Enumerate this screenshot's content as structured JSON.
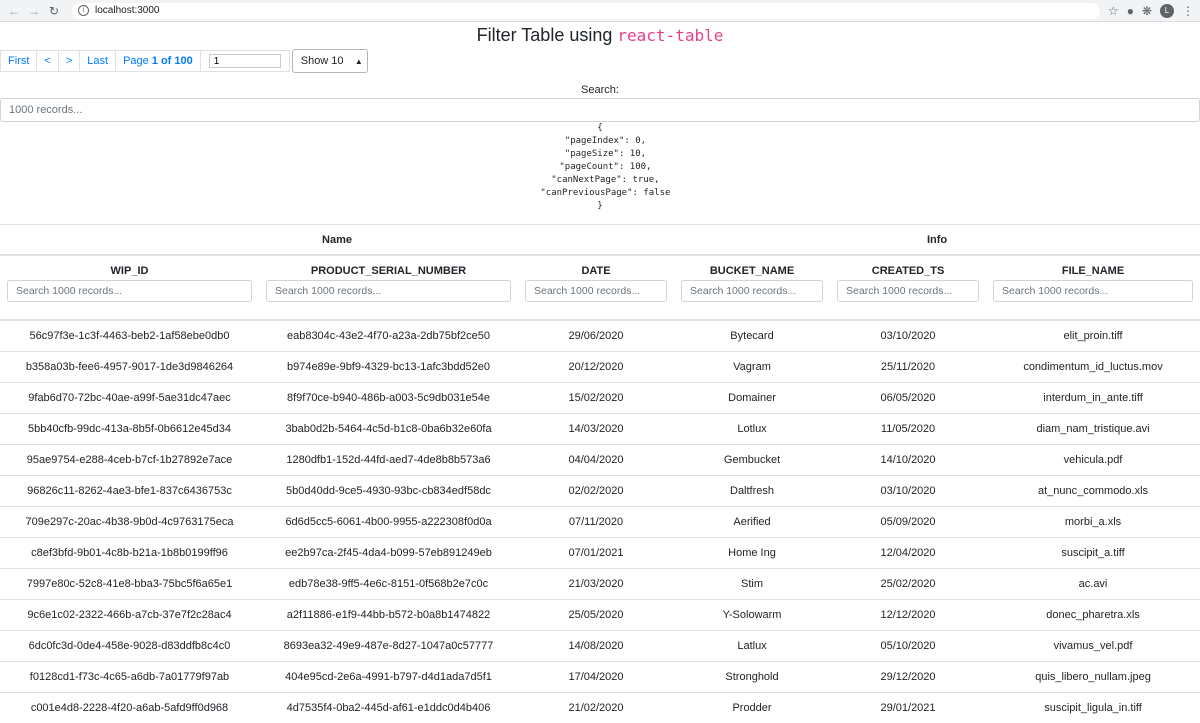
{
  "browser": {
    "url": "localhost:3000",
    "avatar_letter": "L"
  },
  "page": {
    "title_text": "Filter Table using",
    "title_code": "react-table"
  },
  "pagination": {
    "first": "First",
    "prev": "<",
    "next": ">",
    "last": "Last",
    "page_label": "Page",
    "page_value": "1 of 100",
    "goto_value": "1",
    "show_label": "Show 10"
  },
  "search": {
    "label": "Search:",
    "placeholder": "1000 records..."
  },
  "debug_json": "{\n  \"pageIndex\": 0,\n  \"pageSize\": 10,\n  \"pageCount\": 100,\n  \"canNextPage\": true,\n  \"canPreviousPage\": false\n}",
  "table": {
    "groups": [
      "Name",
      "Info"
    ],
    "columns": [
      {
        "title": "WIP_ID",
        "placeholder": "Search 1000 records..."
      },
      {
        "title": "PRODUCT_SERIAL_NUMBER",
        "placeholder": "Search 1000 records..."
      },
      {
        "title": "DATE",
        "placeholder": "Search 1000 records..."
      },
      {
        "title": "BUCKET_NAME",
        "placeholder": "Search 1000 records..."
      },
      {
        "title": "CREATED_TS",
        "placeholder": "Search 1000 records..."
      },
      {
        "title": "FILE_NAME",
        "placeholder": "Search 1000 records..."
      }
    ],
    "rows": [
      [
        "56c97f3e-1c3f-4463-beb2-1af58ebe0db0",
        "eab8304c-43e2-4f70-a23a-2db75bf2ce50",
        "29/06/2020",
        "Bytecard",
        "03/10/2020",
        "elit_proin.tiff"
      ],
      [
        "b358a03b-fee6-4957-9017-1de3d9846264",
        "b974e89e-9bf9-4329-bc13-1afc3bdd52e0",
        "20/12/2020",
        "Vagram",
        "25/11/2020",
        "condimentum_id_luctus.mov"
      ],
      [
        "9fab6d70-72bc-40ae-a99f-5ae31dc47aec",
        "8f9f70ce-b940-486b-a003-5c9db031e54e",
        "15/02/2020",
        "Domainer",
        "06/05/2020",
        "interdum_in_ante.tiff"
      ],
      [
        "5bb40cfb-99dc-413a-8b5f-0b6612e45d34",
        "3bab0d2b-5464-4c5d-b1c8-0ba6b32e60fa",
        "14/03/2020",
        "Lotlux",
        "11/05/2020",
        "diam_nam_tristique.avi"
      ],
      [
        "95ae9754-e288-4ceb-b7cf-1b27892e7ace",
        "1280dfb1-152d-44fd-aed7-4de8b8b573a6",
        "04/04/2020",
        "Gembucket",
        "14/10/2020",
        "vehicula.pdf"
      ],
      [
        "96826c11-8262-4ae3-bfe1-837c6436753c",
        "5b0d40dd-9ce5-4930-93bc-cb834edf58dc",
        "02/02/2020",
        "Daltfresh",
        "03/10/2020",
        "at_nunc_commodo.xls"
      ],
      [
        "709e297c-20ac-4b38-9b0d-4c9763175eca",
        "6d6d5cc5-6061-4b00-9955-a222308f0d0a",
        "07/11/2020",
        "Aerified",
        "05/09/2020",
        "morbi_a.xls"
      ],
      [
        "c8ef3bfd-9b01-4c8b-b21a-1b8b0199ff96",
        "ee2b97ca-2f45-4da4-b099-57eb891249eb",
        "07/01/2021",
        "Home Ing",
        "12/04/2020",
        "suscipit_a.tiff"
      ],
      [
        "7997e80c-52c8-41e8-bba3-75bc5f6a65e1",
        "edb78e38-9ff5-4e6c-8151-0f568b2e7c0c",
        "21/03/2020",
        "Stim",
        "25/02/2020",
        "ac.avi"
      ],
      [
        "9c6e1c02-2322-466b-a7cb-37e7f2c28ac4",
        "a2f11886-e1f9-44bb-b572-b0a8b1474822",
        "25/05/2020",
        "Y-Solowarm",
        "12/12/2020",
        "donec_pharetra.xls"
      ],
      [
        "6dc0fc3d-0de4-458e-9028-d83ddfb8c4c0",
        "8693ea32-49e9-487e-8d27-1047a0c57777",
        "14/08/2020",
        "Latlux",
        "05/10/2020",
        "vivamus_vel.pdf"
      ],
      [
        "f0128cd1-f73c-4c65-a6db-7a01779f97ab",
        "404e95cd-2e6a-4991-b797-d4d1ada7d5f1",
        "17/04/2020",
        "Stronghold",
        "29/12/2020",
        "quis_libero_nullam.jpeg"
      ],
      [
        "c001e4d8-2228-4f20-a6ab-5afd9ff0d968",
        "4d7535f4-0ba2-445d-af61-e1ddc0d4b406",
        "21/02/2020",
        "Prodder",
        "29/01/2021",
        "suscipit_ligula_in.tiff"
      ]
    ]
  }
}
